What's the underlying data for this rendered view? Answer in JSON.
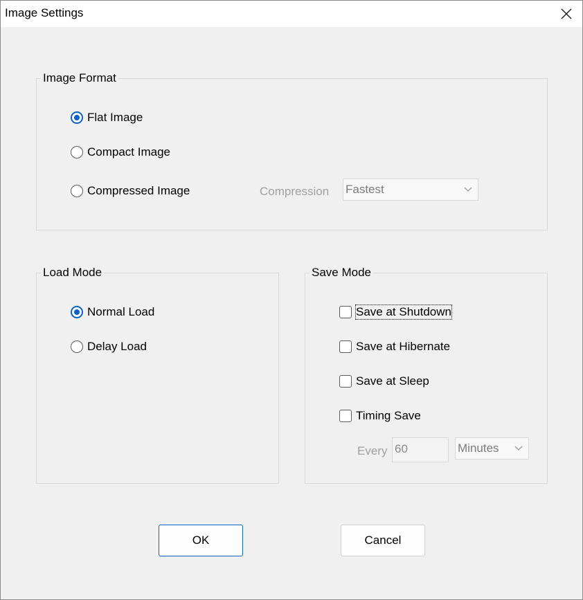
{
  "window": {
    "title": "Image Settings",
    "close_icon": "close-icon"
  },
  "image_format": {
    "label": "Image Format",
    "options": [
      {
        "label": "Flat Image",
        "checked": true
      },
      {
        "label": "Compact Image",
        "checked": false
      },
      {
        "label": "Compressed Image",
        "checked": false
      }
    ],
    "compression_label": "Compression",
    "compression_value": "Fastest"
  },
  "load_mode": {
    "label": "Load Mode",
    "options": [
      {
        "label": "Normal Load",
        "checked": true
      },
      {
        "label": "Delay Load",
        "checked": false
      }
    ]
  },
  "save_mode": {
    "label": "Save Mode",
    "options": [
      {
        "label": "Save at Shutdown",
        "checked": false
      },
      {
        "label": "Save at Hibernate",
        "checked": false
      },
      {
        "label": "Save at Sleep",
        "checked": false
      },
      {
        "label": "Timing Save",
        "checked": false
      }
    ],
    "every_label": "Every",
    "every_value": "60",
    "unit_value": "Minutes"
  },
  "buttons": {
    "ok": "OK",
    "cancel": "Cancel"
  },
  "colors": {
    "accent": "#0a62c7",
    "background": "#f0f0f0"
  }
}
